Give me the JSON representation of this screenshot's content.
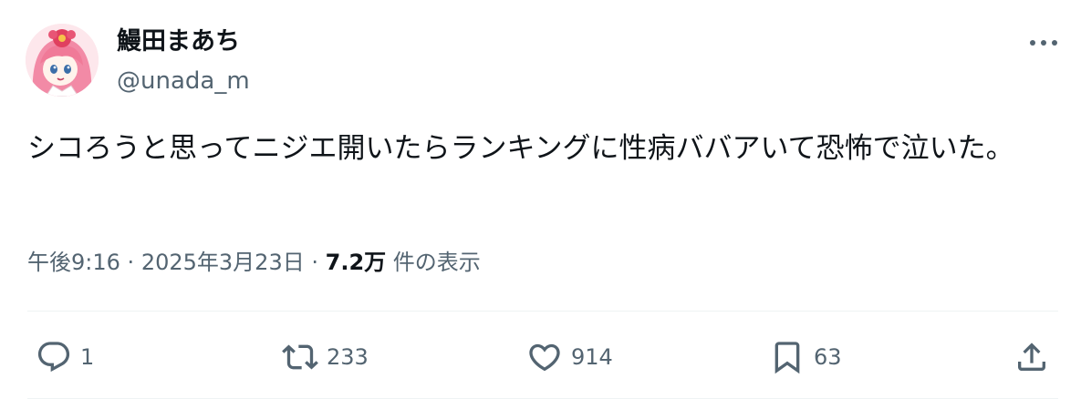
{
  "author": {
    "display_name": "鰻田まあち",
    "handle": "@unada_m",
    "avatar_icon": "anime-avatar-pink-hair"
  },
  "tweet": {
    "text": "シコろうと思ってニジエ開いたらランキングに性病ババアいて恐怖で泣いた。"
  },
  "meta": {
    "time": "午後9:16",
    "separator": "·",
    "date": "2025年3月23日",
    "views_count": "7.2万",
    "views_label": "件の表示"
  },
  "actions": {
    "reply": {
      "icon": "reply-icon",
      "count": "1"
    },
    "retweet": {
      "icon": "retweet-icon",
      "count": "233"
    },
    "like": {
      "icon": "heart-icon",
      "count": "914"
    },
    "bookmark": {
      "icon": "bookmark-icon",
      "count": "63"
    },
    "share": {
      "icon": "share-icon"
    }
  },
  "colors": {
    "text_primary": "#0f1419",
    "text_secondary": "#536471",
    "divider": "#eff3f4"
  }
}
